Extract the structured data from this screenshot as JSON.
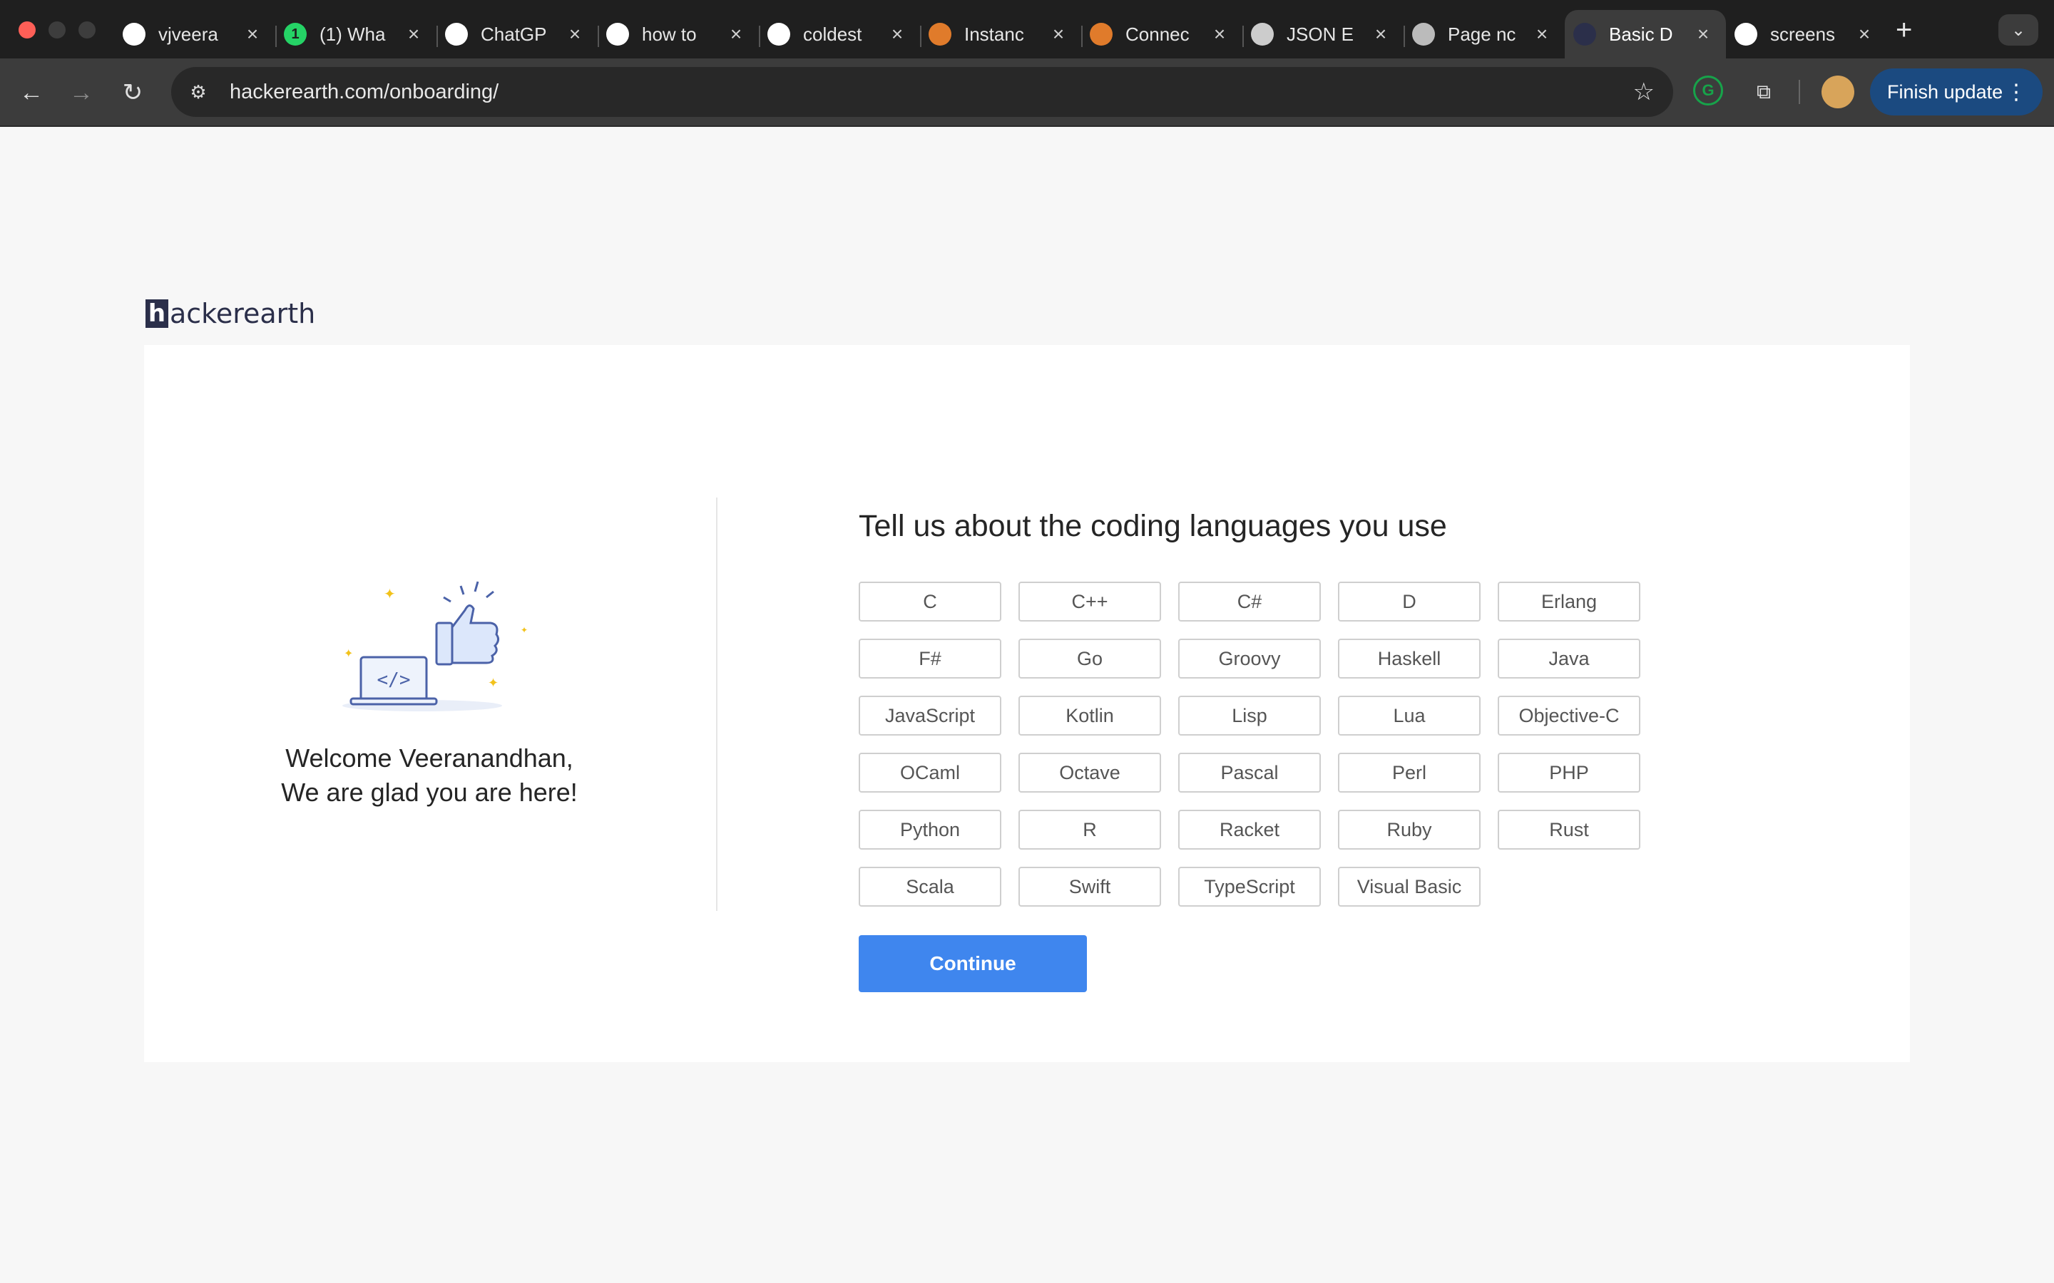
{
  "browser": {
    "tabs": [
      {
        "title": "vjveera",
        "icon": "github-icon",
        "color": "#ffffff"
      },
      {
        "title": "(1) Wha",
        "icon": "whatsapp-icon",
        "badge": "1",
        "color": "#25d366"
      },
      {
        "title": "ChatGP",
        "icon": "chatgpt-icon",
        "color": "#ffffff"
      },
      {
        "title": "how to",
        "icon": "google-icon",
        "color": "#ffffff"
      },
      {
        "title": "coldest",
        "icon": "google-icon",
        "color": "#ffffff"
      },
      {
        "title": "Instanc",
        "icon": "aws-icon",
        "color": "#e07b2b"
      },
      {
        "title": "Connec",
        "icon": "aws-icon",
        "color": "#e07b2b"
      },
      {
        "title": "JSON E",
        "icon": "json-icon",
        "color": "#cccccc"
      },
      {
        "title": "Page nc",
        "icon": "globe-icon",
        "color": "#bbbbbb"
      },
      {
        "title": "Basic D",
        "icon": "hackerearth-icon",
        "color": "#2b2f4a",
        "active": true
      },
      {
        "title": "screens",
        "icon": "google-icon",
        "color": "#ffffff"
      }
    ],
    "url": "hackerearth.com/onboarding/",
    "update_label": "Finish update"
  },
  "page": {
    "logo_text": "ackerearth",
    "logo_letter": "h",
    "welcome_line1": "Welcome Veeranandhan,",
    "welcome_line2": "We are glad you are here!",
    "heading": "Tell us about the coding languages you use",
    "languages": [
      "C",
      "C++",
      "C#",
      "D",
      "Erlang",
      "F#",
      "Go",
      "Groovy",
      "Haskell",
      "Java",
      "JavaScript",
      "Kotlin",
      "Lisp",
      "Lua",
      "Objective-C",
      "OCaml",
      "Octave",
      "Pascal",
      "Perl",
      "PHP",
      "Python",
      "R",
      "Racket",
      "Ruby",
      "Rust",
      "Scala",
      "Swift",
      "TypeScript",
      "Visual Basic"
    ],
    "continue_label": "Continue",
    "accent_color": "#3f86ee"
  }
}
